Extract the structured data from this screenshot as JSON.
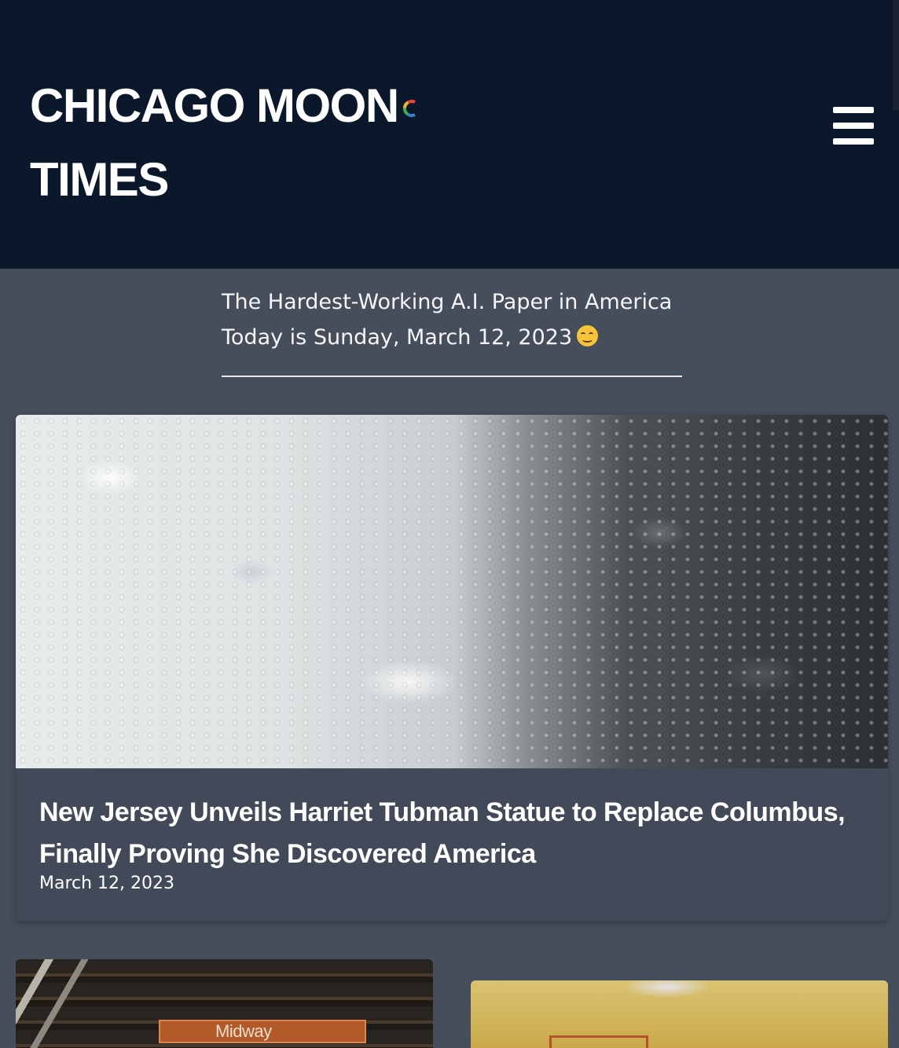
{
  "site": {
    "title_line1": "CHICAGO MOON",
    "title_line2": "TIMES",
    "logo_mark_colors": [
      "#e8453c",
      "#f2b233",
      "#3fae5a",
      "#3b82c4"
    ]
  },
  "header": {
    "background": "#0b172b",
    "menu_icon": "hamburger-menu-icon"
  },
  "tagline": {
    "line1": "The Hardest-Working A.I. Paper in America",
    "line2": "Today is Sunday, March 12, 2023",
    "emoji": "smiling-face-icon"
  },
  "featured": {
    "title": "New Jersey Unveils Harriet Tubman Statue to Replace Columbus, Finally Proving She Discovered America",
    "date": "March 12, 2023",
    "image": "rain-droplets-on-glass"
  },
  "cards": [
    {
      "image": "midway-station-stairs",
      "sign_text": "Midway"
    },
    {
      "image": "gold-painted-building"
    }
  ]
}
